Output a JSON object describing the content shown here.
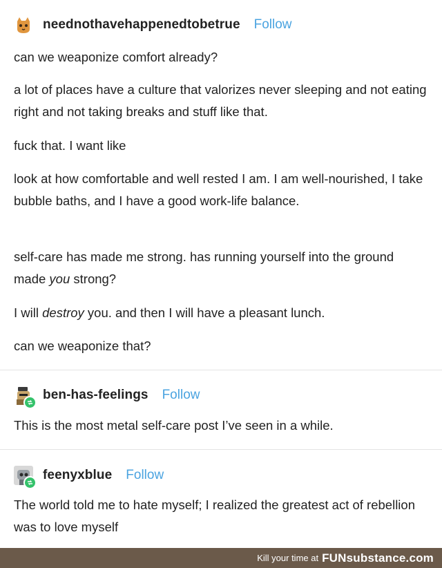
{
  "posts": [
    {
      "username": "neednothavehappenedtobetrue",
      "follow_label": "Follow",
      "avatar_icon": "cat-avatar-icon",
      "paragraphs": [
        "can we weaponize comfort already?",
        "a lot of places have a culture that valorizes never sleeping and not eating right and not taking breaks and stuff like that.",
        "fuck that. I want like",
        "look at how comfortable and well rested I am. I am well-nourished, I take bubble baths, and I have a good work-life balance."
      ],
      "p5_before": "self-care has made me strong. has running yourself into the ground made ",
      "p5_em": "you",
      "p5_after": " strong?",
      "p6_before": "I will ",
      "p6_em": "destroy",
      "p6_after": " you. and then I will have a pleasant lunch.",
      "p7": "can we weaponize that?"
    },
    {
      "username": "ben-has-feelings",
      "follow_label": "Follow",
      "avatar_icon": "character-avatar-icon",
      "text": "This is the most metal self-care post I’ve seen in a while."
    },
    {
      "username": "feenyxblue",
      "follow_label": "Follow",
      "avatar_icon": "robot-avatar-icon",
      "text": "The world told me to hate myself; I realized the greatest act of rebellion was to love myself"
    }
  ],
  "footer": {
    "prefix": "Kill your time at",
    "brand": "FUNsubstance.com"
  },
  "colors": {
    "follow": "#4aa3e0",
    "reblog_badge": "#35c26b",
    "footer_bg": "#6b5a4a"
  }
}
